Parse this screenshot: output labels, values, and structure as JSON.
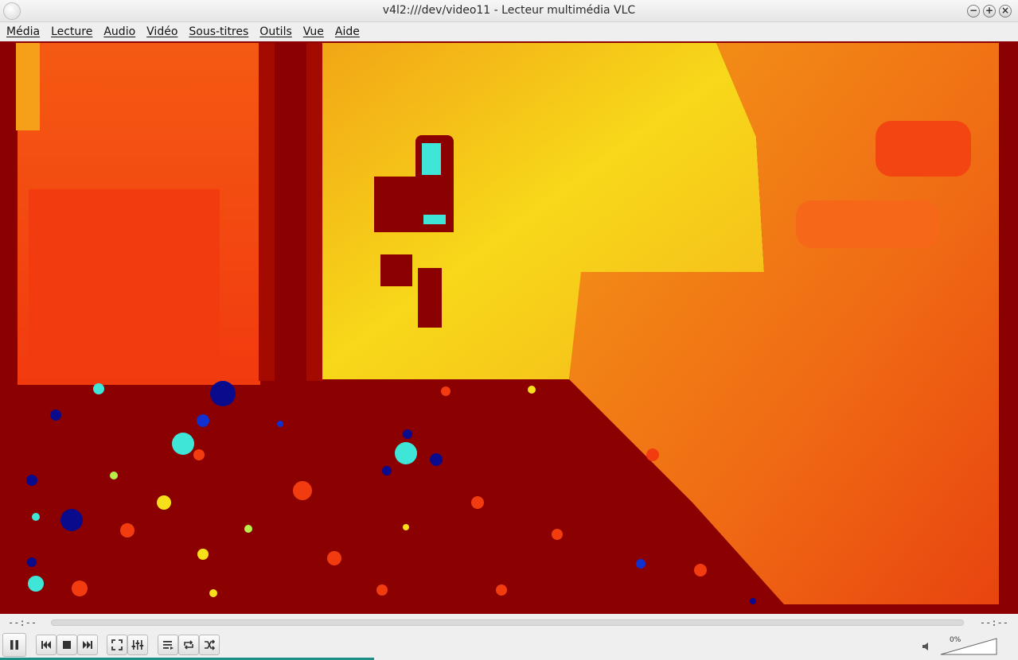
{
  "window": {
    "title": "v4l2:///dev/video11 - Lecteur multimédia VLC",
    "buttons": [
      "−",
      "+",
      "×"
    ]
  },
  "menu": {
    "items": [
      "Média",
      "Lecture",
      "Audio",
      "Vidéo",
      "Sous-titres",
      "Outils",
      "Vue",
      "Aide"
    ]
  },
  "seek": {
    "elapsed": "--:--",
    "remaining": "--:--",
    "progress": 0
  },
  "controls": {
    "buttons": [
      {
        "name": "pause",
        "icon": "pause-icon"
      },
      {
        "name": "previous",
        "icon": "previous-icon"
      },
      {
        "name": "stop",
        "icon": "stop-icon"
      },
      {
        "name": "next",
        "icon": "next-icon"
      },
      {
        "name": "fullscreen",
        "icon": "fullscreen-icon"
      },
      {
        "name": "extended-settings",
        "icon": "equalizer-icon"
      },
      {
        "name": "playlist",
        "icon": "playlist-icon"
      },
      {
        "name": "loop",
        "icon": "loop-icon"
      },
      {
        "name": "random",
        "icon": "shuffle-icon"
      }
    ],
    "volume_label": "0%",
    "volume_level": 0
  },
  "colors": {
    "video_background": "#8b0000",
    "accent": "#1a8f84"
  }
}
